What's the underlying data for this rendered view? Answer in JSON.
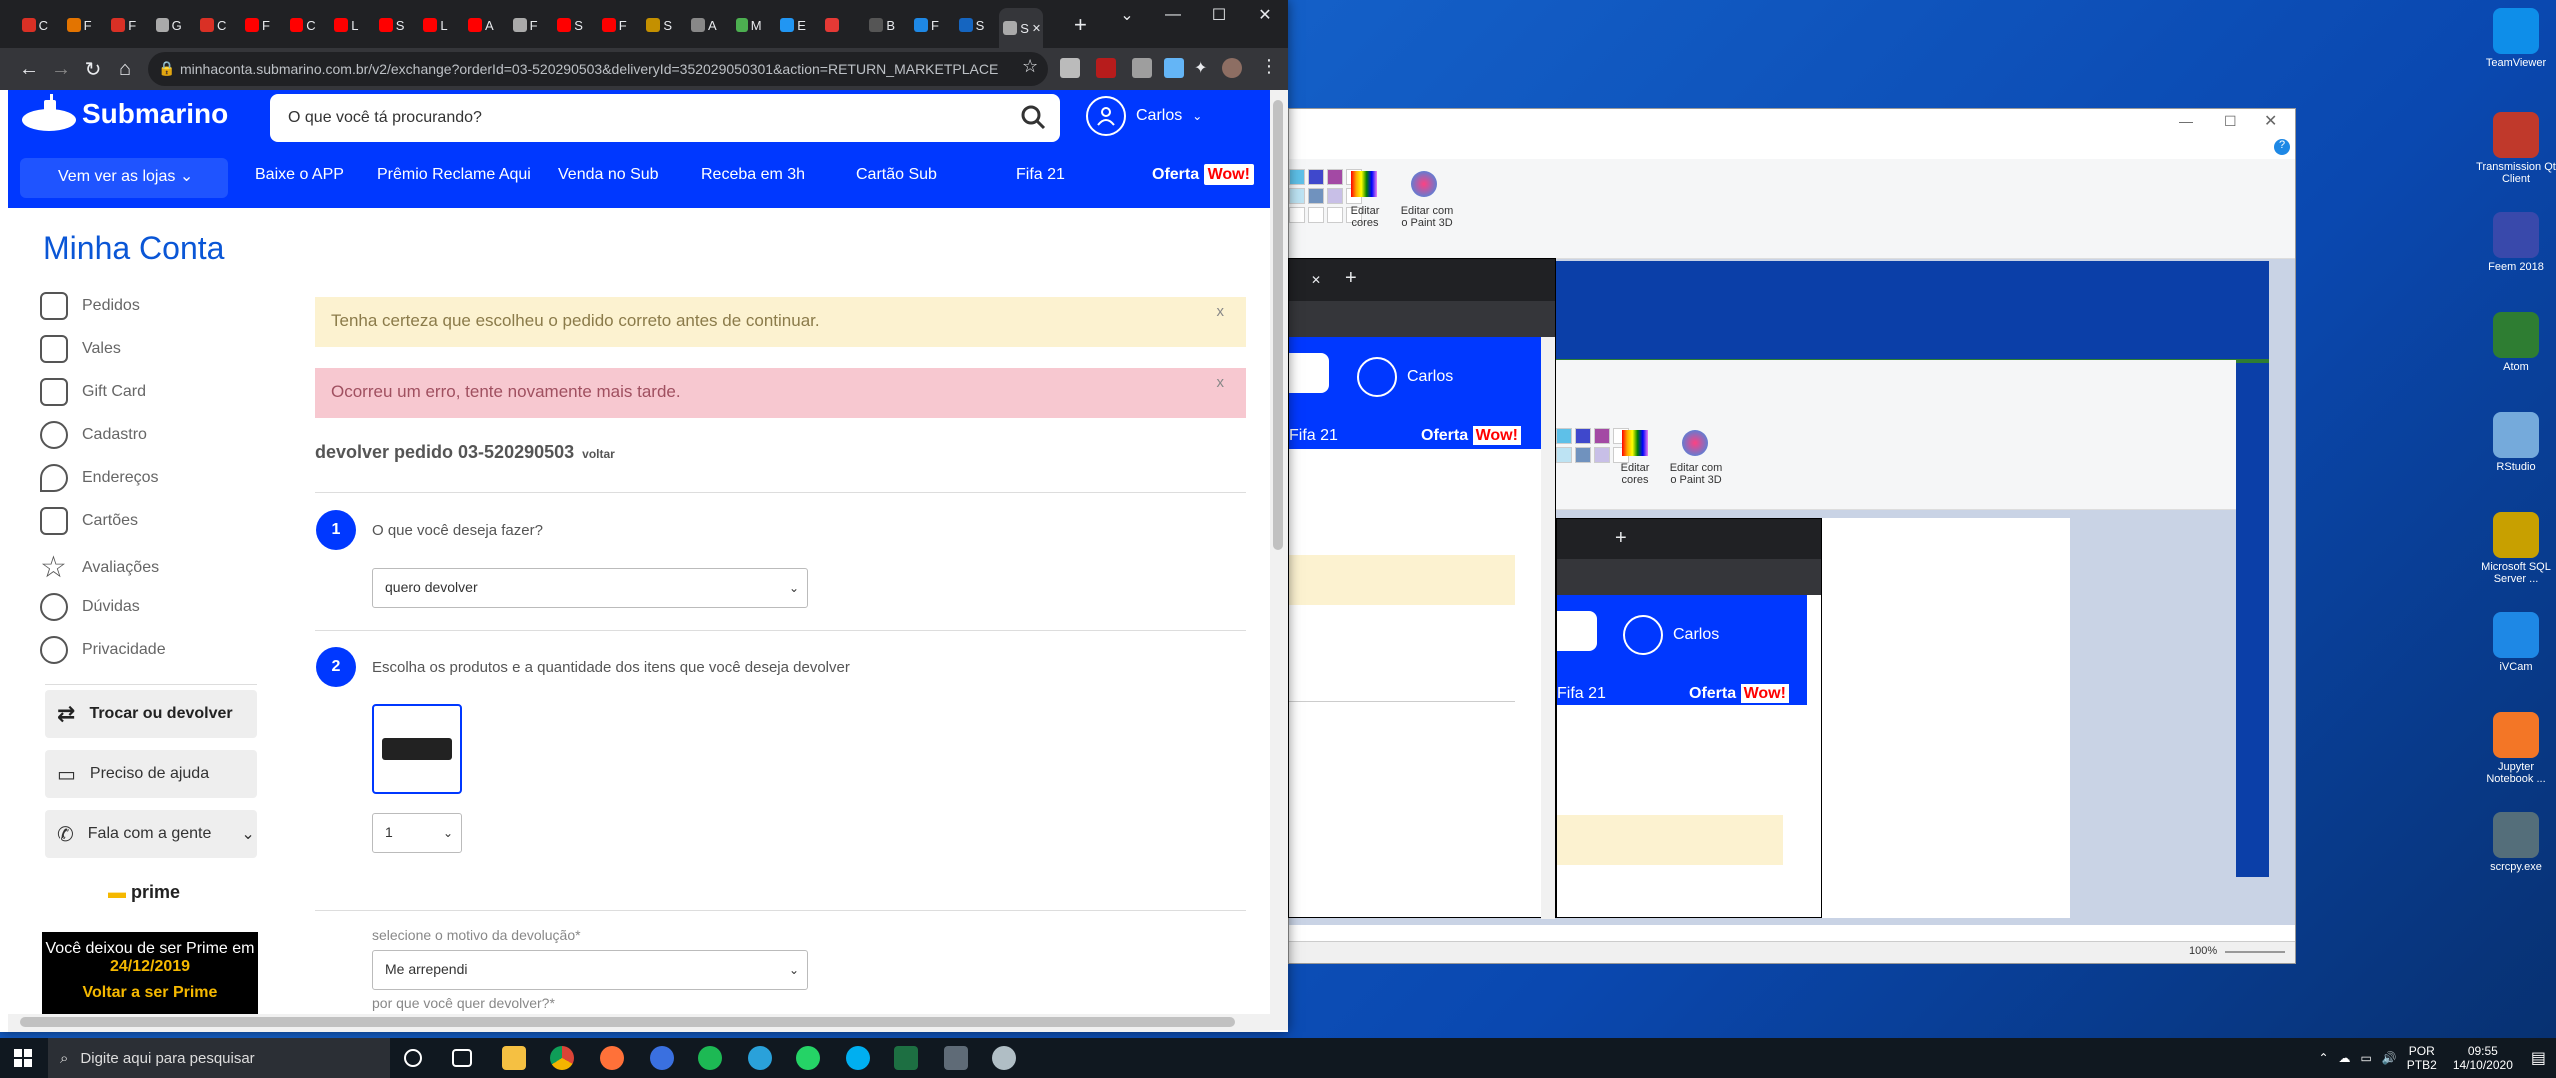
{
  "browser": {
    "tabs": [
      {
        "icon": "gmail-icon",
        "label": "C",
        "color": "#d93025"
      },
      {
        "icon": "chrome-icon",
        "label": "F",
        "color": "#e37400"
      },
      {
        "icon": "gmail-icon",
        "label": "F",
        "color": "#d93025"
      },
      {
        "icon": "github-icon",
        "label": "G",
        "color": "#aaa"
      },
      {
        "icon": "gmail-icon",
        "label": "C",
        "color": "#d93025"
      },
      {
        "icon": "youtube-icon",
        "label": "F",
        "color": "#f00"
      },
      {
        "icon": "youtube-icon",
        "label": "C",
        "color": "#f00"
      },
      {
        "icon": "youtube-icon",
        "label": "L",
        "color": "#f00"
      },
      {
        "icon": "youtube-icon",
        "label": "S",
        "color": "#f00"
      },
      {
        "icon": "youtube-icon",
        "label": "L",
        "color": "#f00"
      },
      {
        "icon": "youtube-icon",
        "label": "A",
        "color": "#f00"
      },
      {
        "icon": "github-icon",
        "label": "F",
        "color": "#aaa"
      },
      {
        "icon": "youtube-icon",
        "label": "S",
        "color": "#f00"
      },
      {
        "icon": "youtube-icon",
        "label": "F",
        "color": "#f00"
      },
      {
        "icon": "s-icon",
        "label": "S",
        "color": "#c49000"
      },
      {
        "icon": "a-icon",
        "label": "A",
        "color": "#888"
      },
      {
        "icon": "m-icon",
        "label": "M",
        "color": "#4caf50"
      },
      {
        "icon": "e-icon",
        "label": "E",
        "color": "#2196f3"
      },
      {
        "icon": "shield-icon",
        "label": "",
        "color": "#e53935"
      },
      {
        "icon": "b-icon",
        "label": "B",
        "color": "#555"
      },
      {
        "icon": "star-icon",
        "label": "F",
        "color": "#1e88e5"
      },
      {
        "icon": "f-icon",
        "label": "S",
        "color": "#1565c0"
      },
      {
        "icon": "s-icon",
        "label": "S",
        "color": "#aaa"
      }
    ],
    "url": "minhaconta.submarino.com.br/v2/exchange?orderId=03-520290503&deliveryId=352029050301&action=RETURN_MARKETPLACE"
  },
  "site": {
    "logo": "Submarino",
    "search_placeholder": "O que você tá procurando?",
    "user": "Carlos",
    "nav": {
      "lojas": "Vem ver as lojas",
      "items": [
        "Baixe o APP",
        "Prêmio Reclame Aqui",
        "Venda no Sub",
        "Receba em 3h",
        "Cartão Sub",
        "Fifa 21"
      ],
      "oferta": "Oferta",
      "wow": "Wow!"
    }
  },
  "account": {
    "title": "Minha Conta",
    "menu": [
      {
        "label": "Pedidos",
        "icon": "box-icon"
      },
      {
        "label": "Vales",
        "icon": "money-icon"
      },
      {
        "label": "Gift Card",
        "icon": "gift-card-icon"
      },
      {
        "label": "Cadastro",
        "icon": "user-icon"
      },
      {
        "label": "Endereços",
        "icon": "location-icon"
      },
      {
        "label": "Cartões",
        "icon": "card-icon"
      },
      {
        "label": "Avaliações",
        "icon": "star-icon"
      },
      {
        "label": "Dúvidas",
        "icon": "question-icon"
      },
      {
        "label": "Privacidade",
        "icon": "lock-icon"
      }
    ],
    "buttons": {
      "trocar": "Trocar ou devolver",
      "ajuda": "Preciso de ajuda",
      "fala": "Fala com a gente"
    },
    "prime": {
      "logo": "prime",
      "msg": "Você deixou de ser Prime em",
      "date": "24/12/2019",
      "cta": "Voltar a ser Prime"
    }
  },
  "exchange": {
    "alert_warning": "Tenha certeza que escolheu o pedido correto antes de continuar.",
    "alert_error": "Ocorreu um erro, tente novamente mais tarde.",
    "title": "devolver pedido 03-520290503",
    "voltar": "voltar",
    "step1": {
      "num": "1",
      "label": "O que você deseja fazer?",
      "value": "quero devolver"
    },
    "step2": {
      "num": "2",
      "label": "Escolha os produtos e a quantidade dos itens que você deseja devolver",
      "qty": "1"
    },
    "motivo_label": "selecione o motivo da devolução*",
    "motivo_value": "Me arrependi",
    "porque_label": "por que você quer devolver?*"
  },
  "paint": {
    "editar_cores": "Editar cores",
    "editar_paint3d": "Editar com o Paint 3D",
    "zoom": "100%"
  },
  "taskbar": {
    "search": "Digite aqui para pesquisar",
    "lang": "POR",
    "layout": "PTB2",
    "time": "09:55",
    "date": "14/10/2020"
  },
  "desktop": [
    {
      "label": "TeamViewer",
      "color": "#0e8ee9"
    },
    {
      "label": "Transmission Qt Client",
      "color": "#c0392b"
    },
    {
      "label": "Feem 2018",
      "color": "#3949ab"
    },
    {
      "label": "Atom",
      "color": "#2e7d32"
    },
    {
      "label": "RStudio",
      "color": "#75aadb"
    },
    {
      "label": "Microsoft SQL Server ...",
      "color": "#c8a000"
    },
    {
      "label": "iVCam",
      "color": "#1e88e5"
    },
    {
      "label": "Jupyter Notebook ...",
      "color": "#f37626"
    },
    {
      "label": "scrcpy.exe",
      "color": "#546e7a"
    }
  ]
}
